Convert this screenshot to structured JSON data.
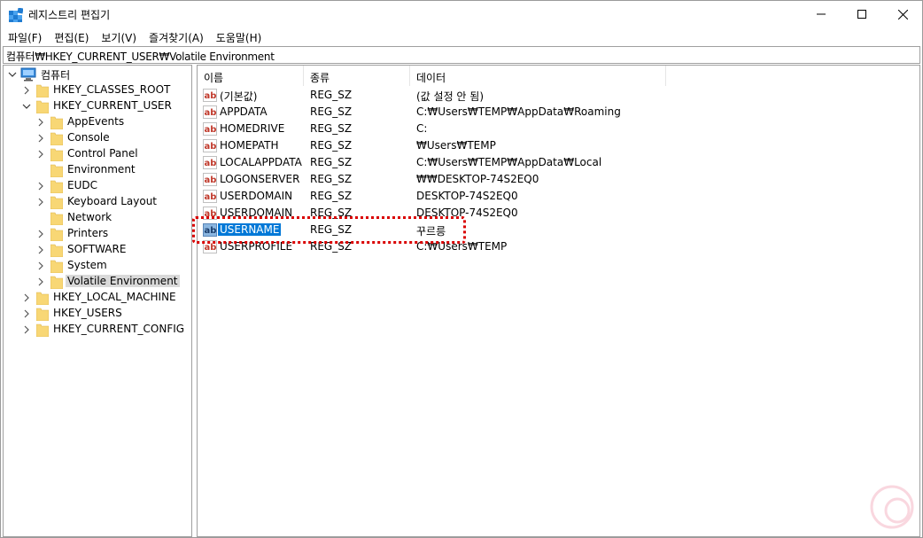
{
  "window": {
    "title": "레지스트리 편집기"
  },
  "menu": [
    "파일(F)",
    "편집(E)",
    "보기(V)",
    "즐겨찾기(A)",
    "도움말(H)"
  ],
  "address": {
    "path": "컴퓨터₩HKEY_CURRENT_USER₩Volatile Environment"
  },
  "tree": {
    "root": "컴퓨터",
    "hives": {
      "classes_root": "HKEY_CLASSES_ROOT",
      "current_user": "HKEY_CURRENT_USER",
      "local_machine": "HKEY_LOCAL_MACHINE",
      "users": "HKEY_USERS",
      "current_config": "HKEY_CURRENT_CONFIG"
    },
    "current_user_children": [
      "AppEvents",
      "Console",
      "Control Panel",
      "Environment",
      "EUDC",
      "Keyboard Layout",
      "Network",
      "Printers",
      "SOFTWARE",
      "System",
      "Volatile Environment"
    ],
    "selected": "Volatile Environment"
  },
  "list": {
    "columns": {
      "name": "이름",
      "type": "종류",
      "data": "데이터"
    },
    "rows": [
      {
        "name": "(기본값)",
        "type": "REG_SZ",
        "data": "(값 설정 안 됨)"
      },
      {
        "name": "APPDATA",
        "type": "REG_SZ",
        "data": "C:₩Users₩TEMP₩AppData₩Roaming"
      },
      {
        "name": "HOMEDRIVE",
        "type": "REG_SZ",
        "data": "C:"
      },
      {
        "name": "HOMEPATH",
        "type": "REG_SZ",
        "data": "₩Users₩TEMP"
      },
      {
        "name": "LOCALAPPDATA",
        "type": "REG_SZ",
        "data": "C:₩Users₩TEMP₩AppData₩Local"
      },
      {
        "name": "LOGONSERVER",
        "type": "REG_SZ",
        "data": "₩₩DESKTOP-74S2EQ0"
      },
      {
        "name": "USERDOMAIN",
        "type": "REG_SZ",
        "data": "DESKTOP-74S2EQ0"
      },
      {
        "name": "USERDOMAIN",
        "type": "REG_SZ",
        "data": "DESKTOP-74S2EQ0"
      },
      {
        "name": "USERNAME",
        "type": "REG_SZ",
        "data": "꾸르릉"
      },
      {
        "name": "USERPROFILE",
        "type": "REG_SZ",
        "data": "C:₩Users₩TEMP"
      }
    ],
    "selected_row": "USERNAME",
    "string_icon_text": "ab"
  },
  "colors": {
    "selection": "#0078d7",
    "tree_selection": "#d9d9d9",
    "annotation": "#d90000",
    "folder": "#f8d775"
  }
}
